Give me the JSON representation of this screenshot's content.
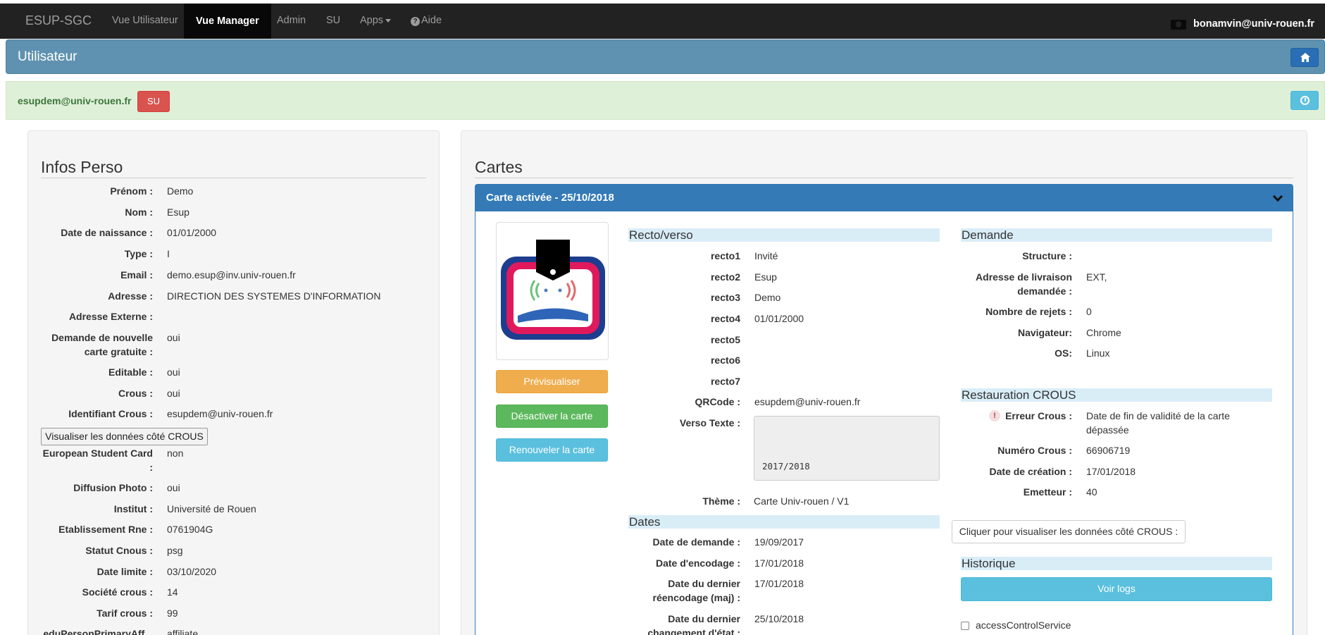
{
  "navbar": {
    "brand": "ESUP-SGC",
    "links": [
      "Vue Utilisateur",
      "Vue Manager",
      "Admin",
      "SU",
      "Apps",
      "Aide"
    ],
    "active": "Vue Manager",
    "user_email": "bonamvin@univ-rouen.fr"
  },
  "header": {
    "title": "Utilisateur",
    "home_icon": "home-icon"
  },
  "su_bar": {
    "email": "esupdem@univ-rouen.fr",
    "su_button": "SU",
    "history_icon": "clock-icon"
  },
  "infos_perso": {
    "title": "Infos Perso",
    "rows": [
      {
        "label": "Prénom :",
        "value": "Demo"
      },
      {
        "label": "Nom :",
        "value": "Esup"
      },
      {
        "label": "Date de naissance :",
        "value": "01/01/2000"
      },
      {
        "label": "Type :",
        "value": "I"
      },
      {
        "label": "Email :",
        "value": "demo.esup@inv.univ-rouen.fr"
      },
      {
        "label": "Adresse :",
        "value": "DIRECTION DES SYSTEMES D'INFORMATION"
      },
      {
        "label": "Adresse Externe :",
        "value": ""
      },
      {
        "label": "Demande de nouvelle carte gratuite :",
        "value": "oui"
      },
      {
        "label": "Editable :",
        "value": "oui"
      },
      {
        "label": "Crous :",
        "value": "oui"
      },
      {
        "label": "Identifiant Crous :",
        "value": "esupdem@univ-rouen.fr"
      },
      {
        "label": "European Student Card :",
        "value": "non"
      },
      {
        "label": "Diffusion Photo :",
        "value": "oui"
      },
      {
        "label": "Institut :",
        "value": "Université de Rouen"
      },
      {
        "label": "Etablissement Rne :",
        "value": "0761904G"
      },
      {
        "label": "Statut Cnous :",
        "value": "psg"
      },
      {
        "label": "Date limite :",
        "value": "03/10/2020"
      },
      {
        "label": "Société crous :",
        "value": "14"
      },
      {
        "label": "Tarif crous :",
        "value": "99"
      },
      {
        "label": "eduPersonPrimaryAff...",
        "value": "affiliate"
      }
    ],
    "crous_button": "Visualiser les données côté CROUS"
  },
  "cartes": {
    "title": "Cartes",
    "panel_heading": "Carte activée - 25/10/2018",
    "buttons": {
      "preview": "Prévisualiser",
      "deactivate": "Désactiver la carte",
      "renew": "Renouveler la carte"
    },
    "recto_verso": {
      "title": "Recto/verso",
      "rows": [
        {
          "label": "recto1",
          "value": "Invité"
        },
        {
          "label": "recto2",
          "value": "Esup"
        },
        {
          "label": "recto3",
          "value": "Demo"
        },
        {
          "label": "recto4",
          "value": "01/01/2000"
        },
        {
          "label": "recto5",
          "value": ""
        },
        {
          "label": "recto6",
          "value": ""
        },
        {
          "label": "recto7",
          "value": ""
        },
        {
          "label": "QRCode :",
          "value": "esupdem@univ-rouen.fr"
        },
        {
          "label": "Verso Texte :",
          "value": ""
        }
      ],
      "verso_text": "2017/2018",
      "theme_label": "Thème :",
      "theme_value": "Carte Univ-rouen / V1"
    },
    "dates": {
      "title": "Dates",
      "rows": [
        {
          "label": "Date de demande :",
          "value": "19/09/2017"
        },
        {
          "label": "Date d'encodage :",
          "value": "17/01/2018"
        },
        {
          "label": "Date du dernier réencodage (maj) :",
          "value": "17/01/2018"
        },
        {
          "label": "Date du dernier changement d'état :",
          "value": "25/10/2018"
        }
      ]
    },
    "demande": {
      "title": "Demande",
      "rows": [
        {
          "label": "Structure :",
          "value": ""
        },
        {
          "label": "Adresse de livraison demandée :",
          "value": "EXT,"
        },
        {
          "label": "Nombre de rejets :",
          "value": "0"
        },
        {
          "label": "Navigateur:",
          "value": "Chrome"
        },
        {
          "label": "OS:",
          "value": "Linux"
        }
      ]
    },
    "restauration": {
      "title": "Restauration CROUS",
      "rows": [
        {
          "label": "Erreur Crous :",
          "value": "Date de fin de validité de la carte dépassée"
        },
        {
          "label": "Numéro Crous :",
          "value": "66906719"
        },
        {
          "label": "Date de création :",
          "value": "17/01/2018"
        },
        {
          "label": "Emetteur :",
          "value": "40"
        }
      ],
      "visual_button": "Cliquer pour visualiser les données côté CROUS :"
    },
    "historique": {
      "title": "Historique",
      "logs_button": "Voir logs",
      "checkbox_label": "accessControlService"
    }
  },
  "colors": {
    "navbar_bg": "#222222",
    "header_bg": "#5f92b0",
    "su_bar_bg": "#dff0d8",
    "panel_primary": "#337ab7",
    "btn_warning": "#f0ad4e",
    "btn_success": "#5cb85c",
    "btn_info": "#5bc0de",
    "btn_danger": "#d9534f"
  }
}
